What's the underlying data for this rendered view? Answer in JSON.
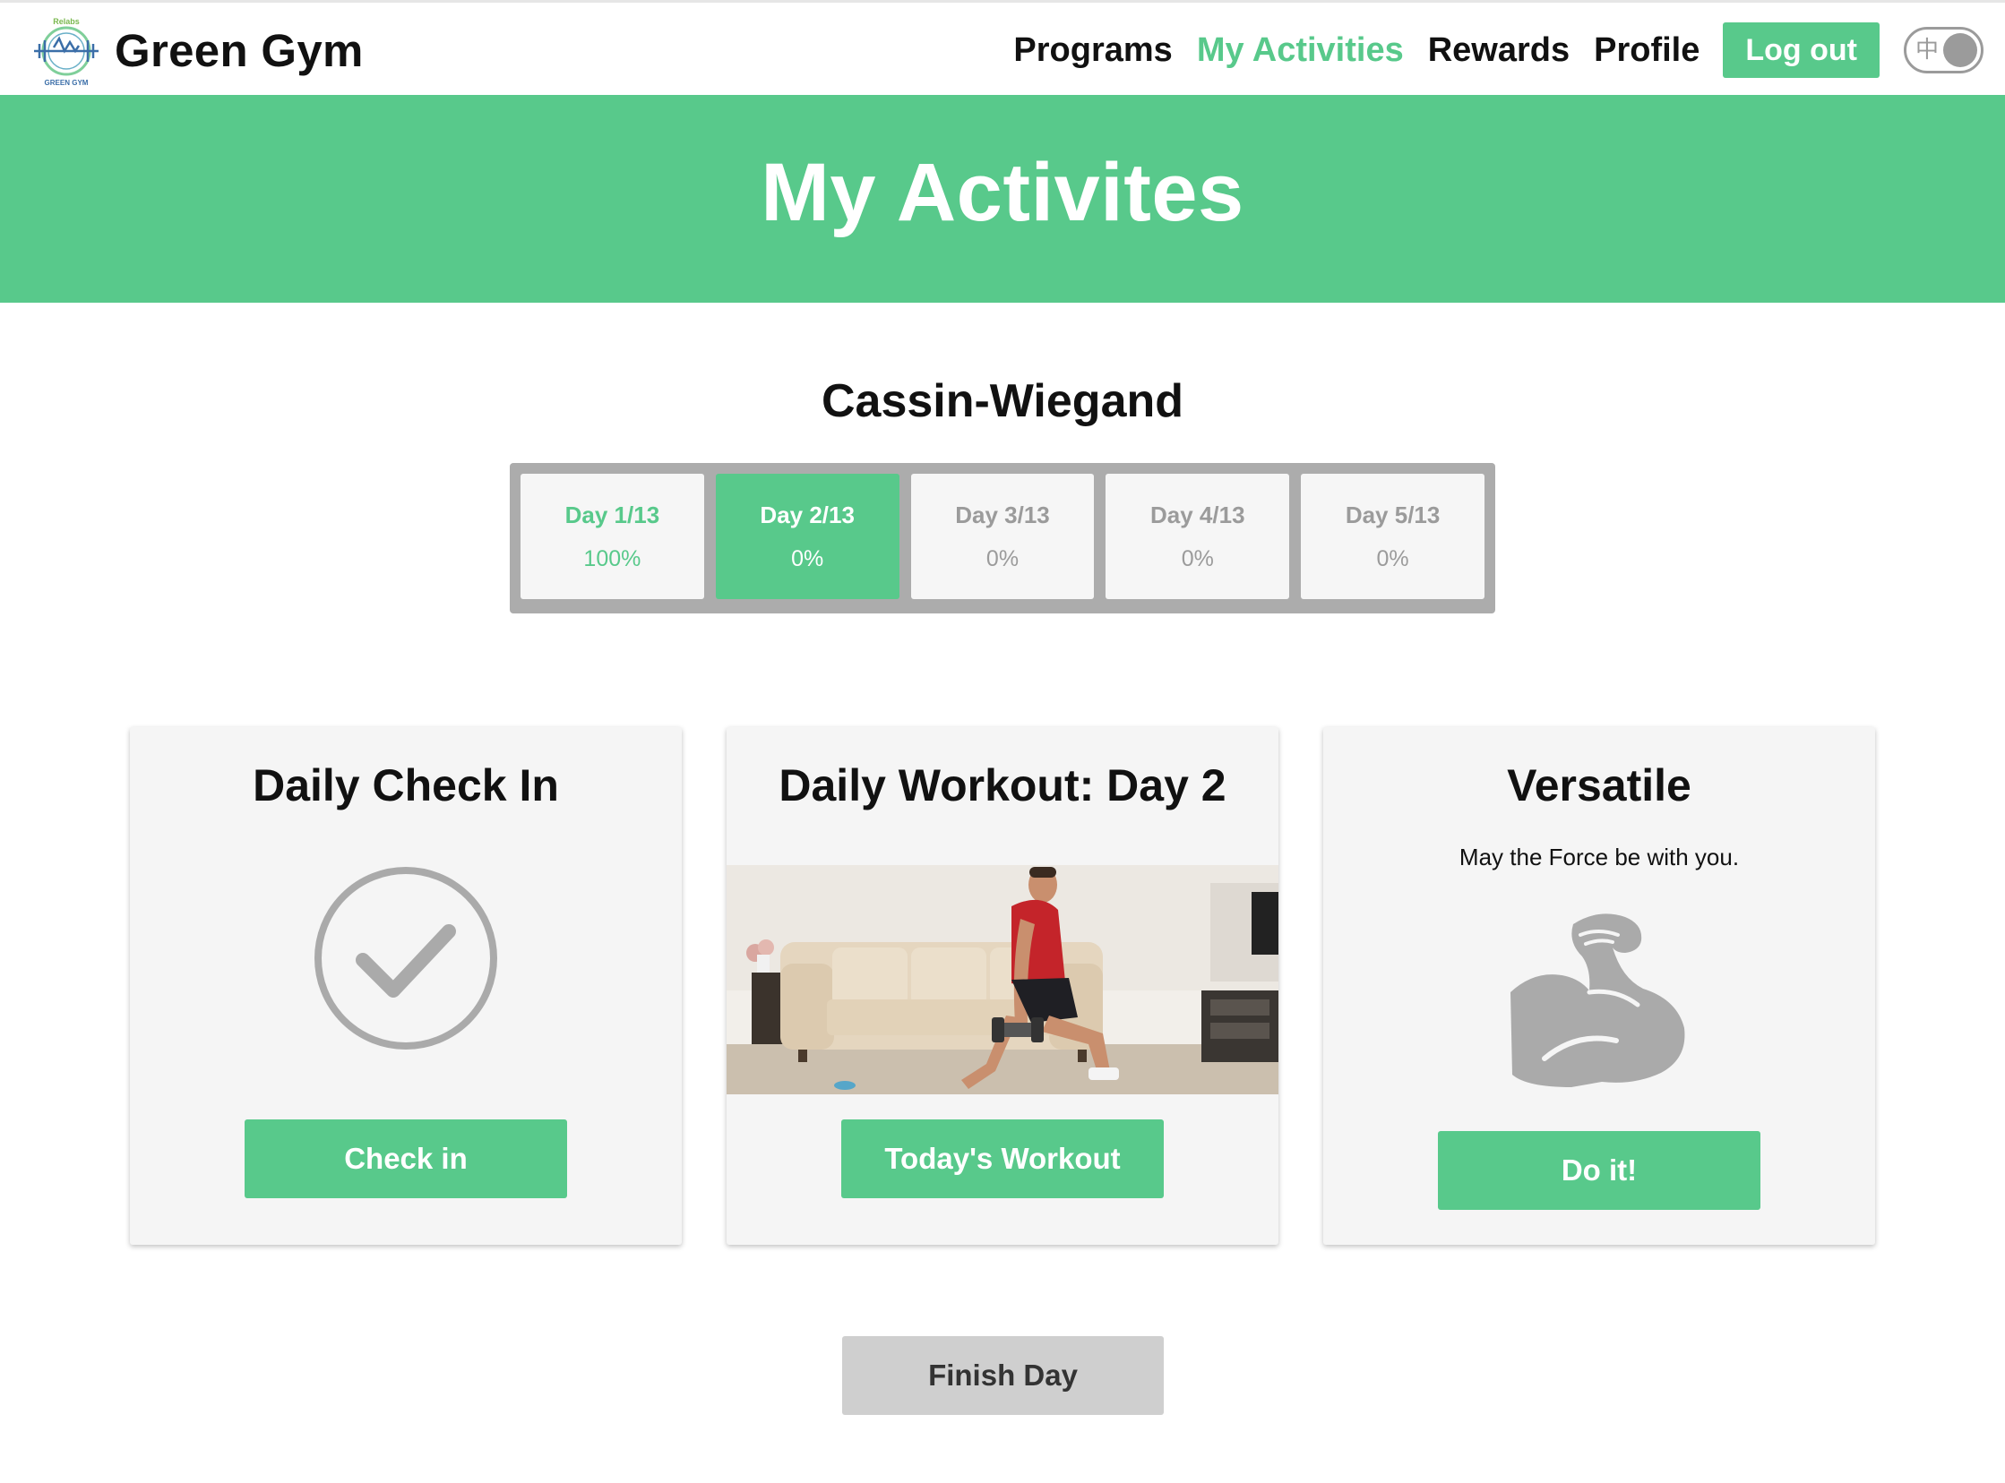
{
  "brand": {
    "name": "Green Gym",
    "logo_text_top": "Relabs",
    "logo_text_bottom": "GREEN GYM"
  },
  "nav": {
    "items": [
      {
        "label": "Programs",
        "active": false
      },
      {
        "label": "My Activities",
        "active": true
      },
      {
        "label": "Rewards",
        "active": false
      },
      {
        "label": "Profile",
        "active": false
      }
    ],
    "logout_label": "Log out",
    "language_toggle_char": "中"
  },
  "hero": {
    "title": "My Activites"
  },
  "program": {
    "title": "Cassin-Wiegand",
    "days": [
      {
        "label": "Day 1/13",
        "progress": "100%",
        "state": "done"
      },
      {
        "label": "Day 2/13",
        "progress": "0%",
        "state": "current"
      },
      {
        "label": "Day 3/13",
        "progress": "0%",
        "state": "upcoming"
      },
      {
        "label": "Day 4/13",
        "progress": "0%",
        "state": "upcoming"
      },
      {
        "label": "Day 5/13",
        "progress": "0%",
        "state": "upcoming"
      }
    ]
  },
  "cards": {
    "checkin": {
      "title": "Daily Check In",
      "icon": "check-circle-icon",
      "button": "Check in"
    },
    "workout": {
      "title": "Daily Workout: Day 2",
      "image": "man-lunging-with-dumbbells-in-living-room",
      "button": "Today's Workout"
    },
    "versatile": {
      "title": "Versatile",
      "subtitle": "May the Force be with you.",
      "icon": "flexed-arm-icon",
      "button": "Do it!"
    }
  },
  "finish_day_label": "Finish Day",
  "colors": {
    "accent": "#58c98b",
    "muted_gray": "#9b9b9b",
    "card_bg": "#f5f5f5",
    "finish_bg": "#cfcfcf"
  }
}
